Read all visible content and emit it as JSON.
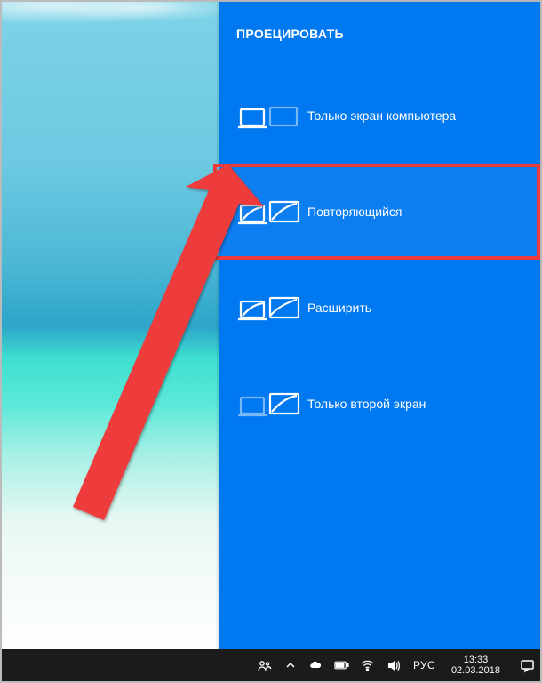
{
  "panel": {
    "title": "ПРОЕЦИРОВАТЬ",
    "options": [
      {
        "label": "Только экран компьютера"
      },
      {
        "label": "Повторяющийся"
      },
      {
        "label": "Расширить"
      },
      {
        "label": "Только второй экран"
      }
    ]
  },
  "taskbar": {
    "language": "РУС",
    "time": "13:33",
    "date": "02.03.2018"
  },
  "annotation": {
    "highlight_color": "#ee3a3a"
  }
}
